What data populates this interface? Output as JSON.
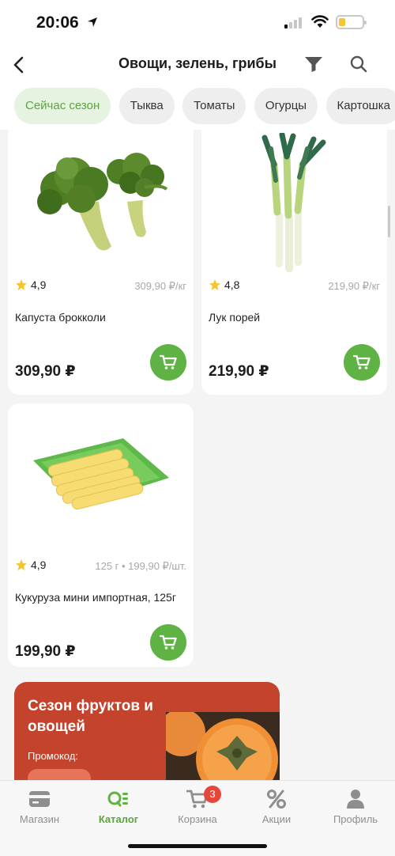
{
  "status": {
    "time": "20:06"
  },
  "header": {
    "title": "Овощи, зелень, грибы"
  },
  "chips": [
    "Сейчас сезон",
    "Тыква",
    "Томаты",
    "Огурцы",
    "Картошка"
  ],
  "products": [
    {
      "rating": "4,9",
      "unit_price": "309,90 ₽/кг",
      "name": "Капуста брокколи",
      "price": "309,90 ₽",
      "icon": "broccoli-image"
    },
    {
      "rating": "4,8",
      "unit_price": "219,90 ₽/кг",
      "name": "Лук порей",
      "price": "219,90 ₽",
      "icon": "leek-image"
    },
    {
      "rating": "4,9",
      "unit_price": "125 г • 199,90 ₽/шт.",
      "name": "Кукуруза мини импортная, 125г",
      "price": "199,90 ₽",
      "icon": "baby-corn-image"
    }
  ],
  "promo": {
    "title": "Сезон фруктов и овощей",
    "code_label": "Промокод:"
  },
  "tabs": [
    {
      "label": "Магазин",
      "icon": "card-icon"
    },
    {
      "label": "Каталог",
      "icon": "catalog-icon"
    },
    {
      "label": "Корзина",
      "icon": "cart-icon",
      "badge": "3"
    },
    {
      "label": "Акции",
      "icon": "percent-icon"
    },
    {
      "label": "Профиль",
      "icon": "profile-icon"
    }
  ],
  "colors": {
    "accent": "#5fb244",
    "promo": "#c4432c",
    "badge": "#e5483a"
  }
}
